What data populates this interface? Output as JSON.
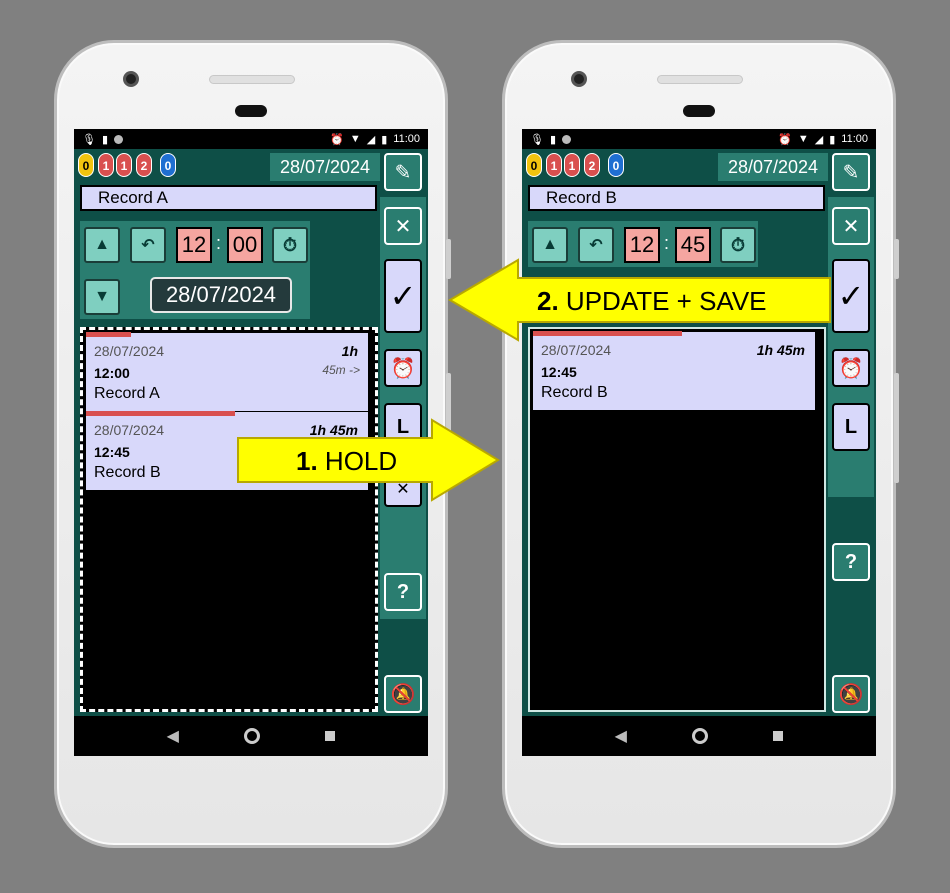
{
  "status": {
    "time": "11:00"
  },
  "counters": [
    "0",
    "1",
    "1",
    "2",
    "0"
  ],
  "counter_colors": [
    "#f1c40f",
    "#d9504f",
    "#d9504f",
    "#d9504f",
    "#1f6fd1"
  ],
  "left": {
    "top_date": "28/07/2024",
    "record_name": "Record A",
    "hour": "12",
    "minute": "00",
    "date_field": "28/07/2024",
    "records": [
      {
        "date": "28/07/2024",
        "time": "12:00",
        "name": "Record A",
        "duration": "1h",
        "next": "45m ->"
      },
      {
        "date": "28/07/2024",
        "time": "12:45",
        "name": "Record B",
        "duration": "1h 45m"
      }
    ],
    "progress": [
      0.16,
      0.53
    ]
  },
  "right": {
    "top_date": "28/07/2024",
    "record_name": "Record B",
    "hour": "12",
    "minute": "45",
    "records": [
      {
        "date": "28/07/2024",
        "time": "12:45",
        "name": "Record B",
        "duration": "1h 45m"
      }
    ],
    "progress": [
      0.53
    ]
  },
  "sidebar": {
    "confirm": "✓",
    "close": "✕",
    "alarm": "⏰",
    "letter": "L",
    "help": "?",
    "bell_off": "🔕"
  },
  "annotations": {
    "step1_num": "1.",
    "step1_text": "HOLD",
    "step2_num": "2.",
    "step2_text": "UPDATE + SAVE"
  },
  "colors": {
    "app_bg": "#0e4f47",
    "panel": "#2a7d70",
    "record_bg": "#d8d8fa",
    "time_box": "#f5a5a0",
    "arrow": "#ffff00"
  }
}
